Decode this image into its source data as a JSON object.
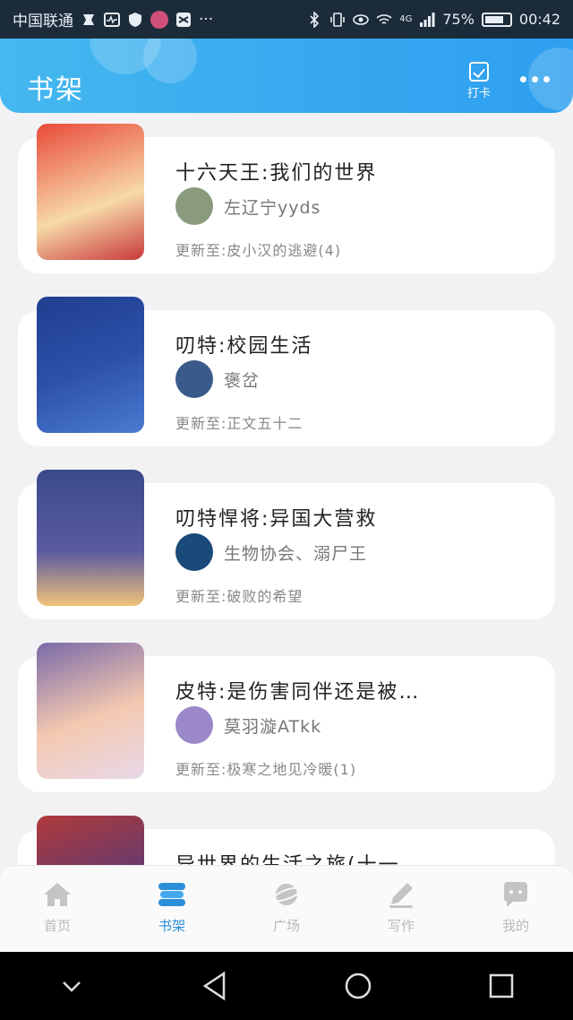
{
  "status_bar": {
    "carrier": "中国联通",
    "network": "4G",
    "battery": "75%",
    "time": "00:42"
  },
  "header": {
    "title": "书架",
    "checkin_label": "打卡"
  },
  "books": [
    {
      "title": "十六天王:我们的世界",
      "author": "左辽宁yyds",
      "update": "更新至:皮小汉的逃避(4)",
      "cover_colors": [
        "#e94a3a",
        "#f7d9a8"
      ],
      "avatar_color": "#8a9a7c"
    },
    {
      "title": "叨特:校园生活",
      "author": "褒岔",
      "update": "更新至:正文五十二",
      "cover_colors": [
        "#1f3f8f",
        "#4a7bd1"
      ],
      "avatar_color": "#3a5a8a"
    },
    {
      "title": "叨特悍将:异国大营救",
      "author": "生物协会、溺尸王",
      "update": "更新至:破败的希望",
      "cover_colors": [
        "#3a4a8a",
        "#f2c27a"
      ],
      "avatar_color": "#1a4a7a"
    },
    {
      "title": "皮特:是伤害同伴还是被…",
      "author": "莫羽漩ATkk",
      "update": "更新至:极寒之地见冷暖(1)",
      "cover_colors": [
        "#7a6aa8",
        "#f4c9b0"
      ],
      "avatar_color": "#9a88c8"
    },
    {
      "title": "异世界的生活之旅(十一…",
      "author": "",
      "update": "",
      "cover_colors": [
        "#b03a3a",
        "#3a3a7a"
      ],
      "avatar_color": "#cccccc"
    }
  ],
  "tabbar": {
    "tabs": [
      {
        "label": "首页",
        "icon": "home-icon"
      },
      {
        "label": "书架",
        "icon": "bookshelf-icon"
      },
      {
        "label": "广场",
        "icon": "planet-icon"
      },
      {
        "label": "写作",
        "icon": "pen-icon"
      },
      {
        "label": "我的",
        "icon": "chat-face-icon"
      }
    ],
    "active_index": 1,
    "active_color": "#2a8fd8",
    "inactive_color": "#c4c4c4"
  }
}
